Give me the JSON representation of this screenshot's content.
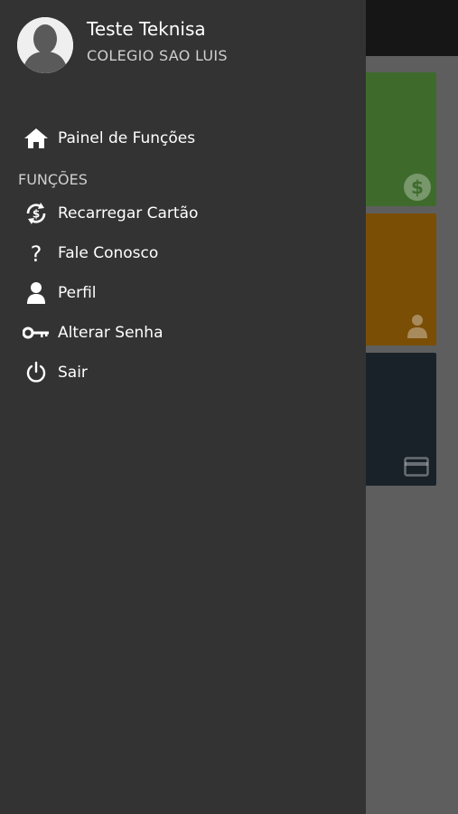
{
  "profile": {
    "name": "Teste Teknisa",
    "school": "COLEGIO SAO LUIS"
  },
  "menu": {
    "dashboard_label": "Painel de Funções",
    "section_label": "FUNÇÕES",
    "items": [
      {
        "label": "Recarregar Cartão",
        "icon": "recharge-icon"
      },
      {
        "label": "Fale Conosco",
        "icon": "question-icon"
      },
      {
        "label": "Perfil",
        "icon": "user-icon"
      },
      {
        "label": "Alterar Senha",
        "icon": "key-icon"
      },
      {
        "label": "Sair",
        "icon": "power-icon"
      }
    ]
  },
  "colors": {
    "drawer_bg": "#333333",
    "tile_green": "#3e6b2c",
    "tile_orange": "#7a4e05",
    "tile_navy": "#1a2229"
  }
}
